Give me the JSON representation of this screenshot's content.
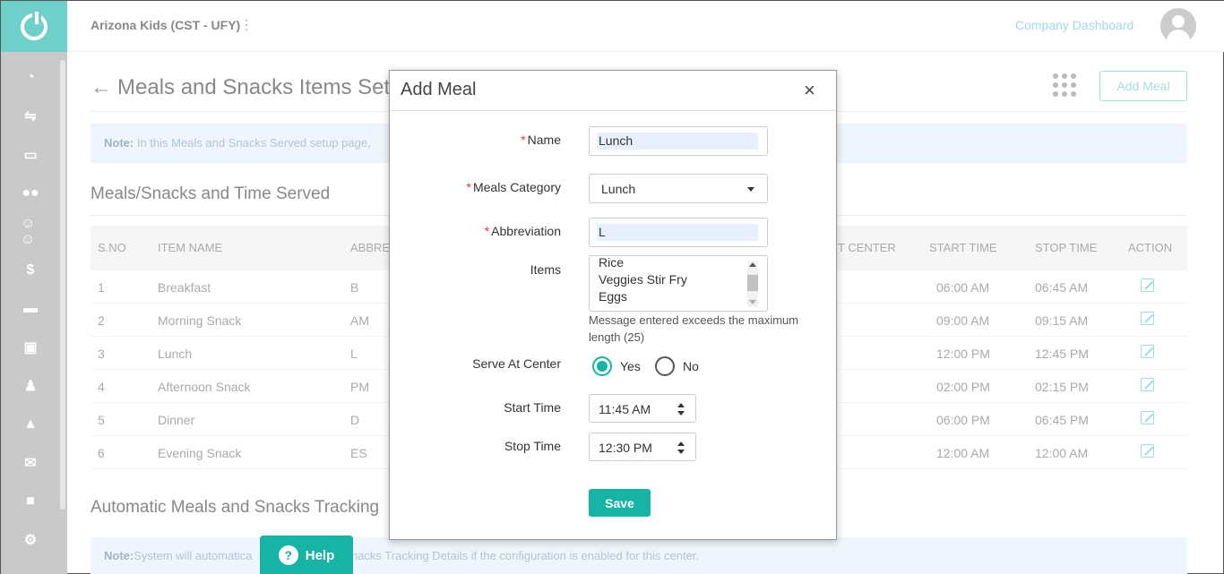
{
  "topbar": {
    "center_name": "Arizona Kids (CST - UFY)",
    "company_link": "Company Dashboard"
  },
  "page": {
    "title": "Meals and Snacks Items Setu",
    "add_meal_label": "Add Meal",
    "note_bold": "Note:",
    "note_text": " In this Meals and Snacks Served setup page,",
    "section_title": "Meals/Snacks and Time Served",
    "table": {
      "headers": {
        "sno": "S.NO",
        "item": "ITEM NAME",
        "abbr": "ABBRE",
        "serve": "T CENTER",
        "start": "START TIME",
        "stop": "STOP TIME",
        "action": "ACTION"
      },
      "rows": [
        {
          "sno": "1",
          "item": "Breakfast",
          "abbr": "B",
          "start": "06:00 AM",
          "stop": "06:45 AM"
        },
        {
          "sno": "2",
          "item": "Morning Snack",
          "abbr": "AM",
          "start": "09:00 AM",
          "stop": "09:15 AM"
        },
        {
          "sno": "3",
          "item": "Lunch",
          "abbr": "L",
          "start": "12:00 PM",
          "stop": "12:45 PM"
        },
        {
          "sno": "4",
          "item": "Afternoon Snack",
          "abbr": "PM",
          "start": "02:00 PM",
          "stop": "02:15 PM"
        },
        {
          "sno": "5",
          "item": "Dinner",
          "abbr": "D",
          "start": "06:00 PM",
          "stop": "06:45 PM"
        },
        {
          "sno": "6",
          "item": "Evening Snack",
          "abbr": "ES",
          "start": "12:00 AM",
          "stop": "12:00 AM"
        }
      ]
    },
    "section2_title": "Automatic Meals and Snacks Tracking",
    "note2_bold": "Note:",
    "note2_text": "System will automatica",
    "note2_text_right": "ls and Snacks Tracking Details if the configuration is enabled for this center."
  },
  "help": {
    "label": "Help"
  },
  "modal": {
    "title": "Add Meal",
    "close": "×",
    "name_label": "Name",
    "name_value": "Lunch",
    "category_label": "Meals Category",
    "category_value": "Lunch",
    "abbr_label": "Abbreviation",
    "abbr_value": "L",
    "items_label": "Items",
    "items": [
      "Rice",
      "Veggies Stir Fry",
      "Eggs"
    ],
    "error": "Message entered exceeds the maximum length (25)",
    "serve_label": "Serve At Center",
    "yes_label": "Yes",
    "no_label": "No",
    "serve_selected": "Yes",
    "start_label": "Start Time",
    "start_value": "11:45 AM",
    "stop_label": "Stop Time",
    "stop_value": "12:30 PM",
    "save_label": "Save"
  },
  "colors": {
    "accent": "#17b3a5",
    "logo_bg": "#6fd0c9",
    "sidebar_bg": "#c9c9c9",
    "required": "#e53935"
  }
}
